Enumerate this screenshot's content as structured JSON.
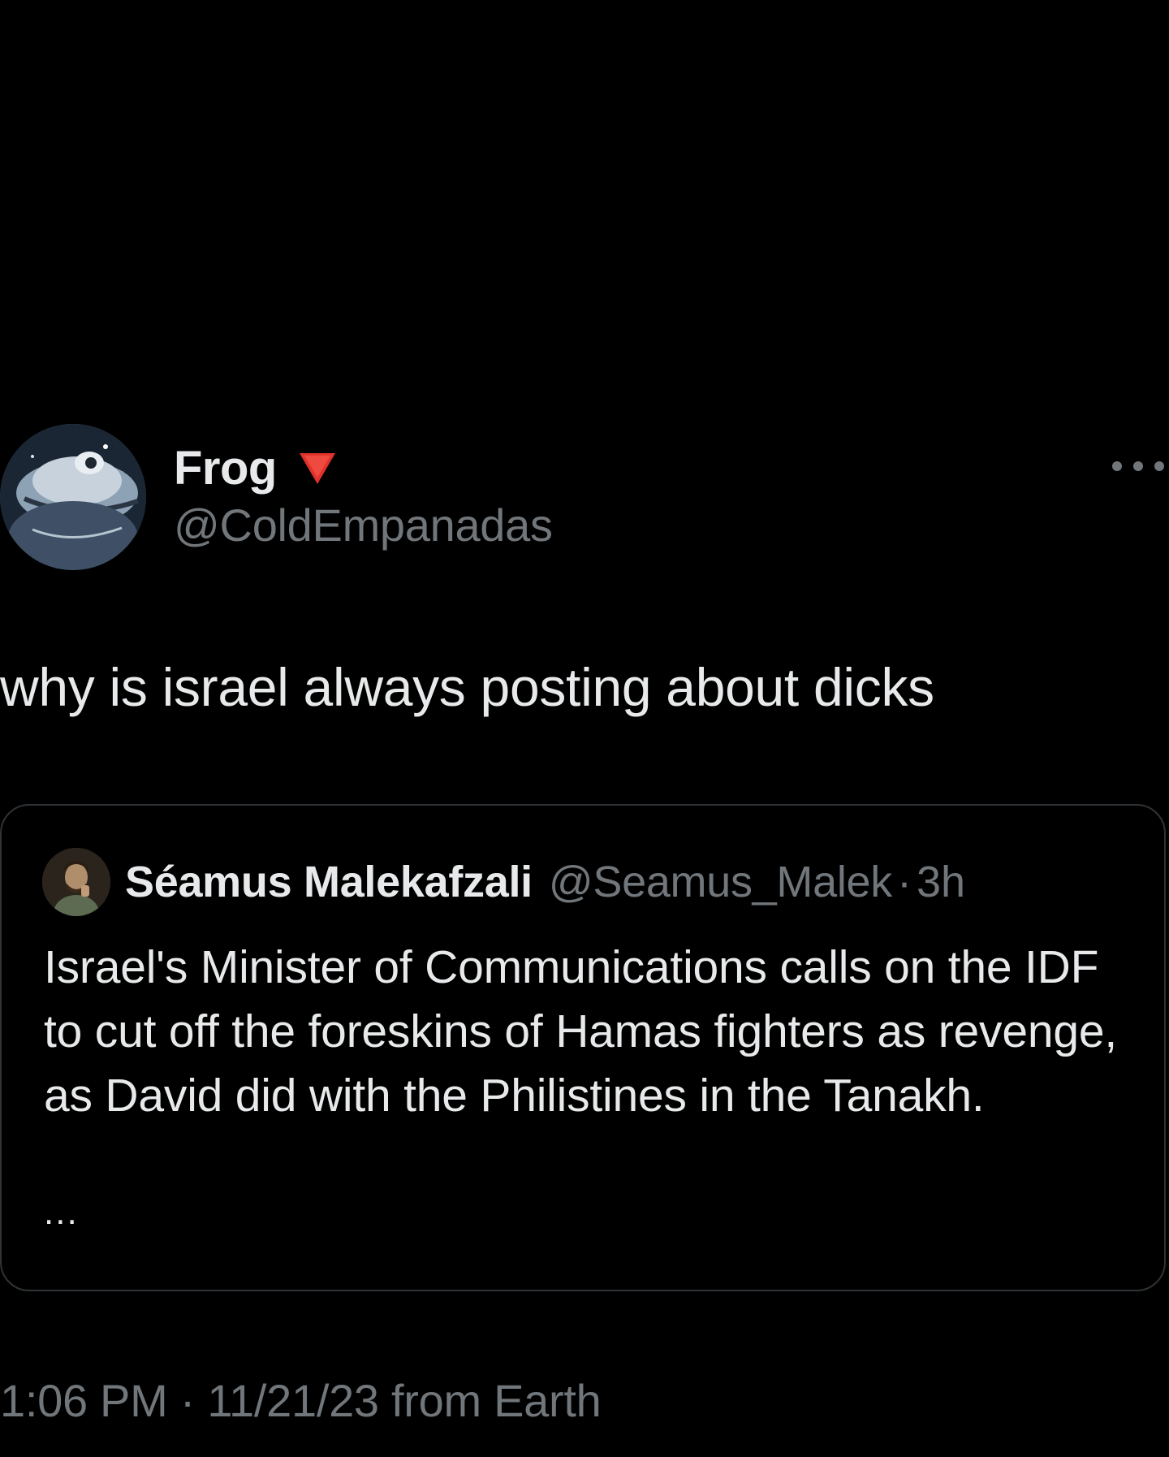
{
  "author": {
    "display_name": "Frog",
    "badge_icon": "red-triangle-down-icon",
    "badge_color": "#e0322b",
    "handle": "@ColdEmpanadas",
    "avatar_icon": "frog-avatar"
  },
  "more_icon": "more-horizontal-icon",
  "tweet": {
    "text": "why is israel always posting about dicks"
  },
  "quote": {
    "avatar_icon": "user-avatar",
    "display_name": "Séamus Malekafzali",
    "handle": "@Seamus_Malek",
    "separator": "·",
    "time": "3h",
    "text": "Israel's Minister of Communications calls on the IDF to cut off the foreskins of Hamas fighters as revenge, as David did with the Philistines in the Tanakh.",
    "ellipsis": "..."
  },
  "meta": {
    "time": "1:06 PM",
    "separator": "·",
    "date": "11/21/23",
    "source": "from Earth"
  },
  "colors": {
    "background": "#000000",
    "text_primary": "#e7e9ea",
    "text_secondary": "#71767b",
    "border": "#2f3336"
  }
}
